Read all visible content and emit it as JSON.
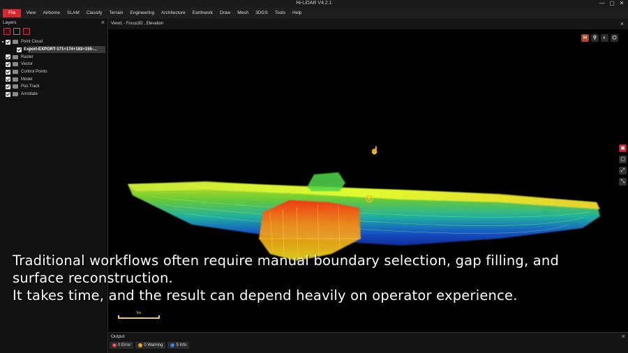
{
  "app": {
    "title": "Hi-LiDAR V4.2.1"
  },
  "window_controls": [
    "—",
    "▢",
    "✕"
  ],
  "menu": [
    "File",
    "View",
    "Airborne",
    "SLAM",
    "Classify",
    "Terrain",
    "Engineering",
    "Architecture",
    "Earthwork",
    "Draw",
    "Mesh",
    "3DGS",
    "Tools",
    "Help"
  ],
  "layers": {
    "title": "Layers",
    "close": "×",
    "items": [
      {
        "label": "Point Cloud",
        "expanded": true
      },
      {
        "label": "Export-EXPORT-171+174+163+155-...",
        "child": true,
        "selected": true
      },
      {
        "label": "Raster"
      },
      {
        "label": "Vector"
      },
      {
        "label": "Control Points"
      },
      {
        "label": "Model"
      },
      {
        "label": "Pos Track"
      },
      {
        "label": "Annotate"
      }
    ]
  },
  "view": {
    "tab": "View1 - Focus3D , Elevation",
    "close": "×",
    "top_icons": [
      "H",
      "⚲",
      "◐",
      "⬡"
    ],
    "side_icons": [
      "▣",
      "▢",
      "⤢",
      "⤡"
    ],
    "scale_label": "5m"
  },
  "output": {
    "title": "Output",
    "close": "×",
    "badges": [
      {
        "label": "0 Error",
        "kind": "error"
      },
      {
        "label": "0 Warning",
        "kind": "warning"
      },
      {
        "label": "5 Info",
        "kind": "info"
      }
    ]
  },
  "subtitle": {
    "line1": "Traditional workflows often require manual boundary selection, gap filling, and",
    "line2": "surface reconstruction.",
    "line3": "It takes time, and the result can depend heavily on operator experience."
  },
  "colors": {
    "accent": "#d8262a",
    "background": "#000000",
    "panel": "#111111"
  }
}
